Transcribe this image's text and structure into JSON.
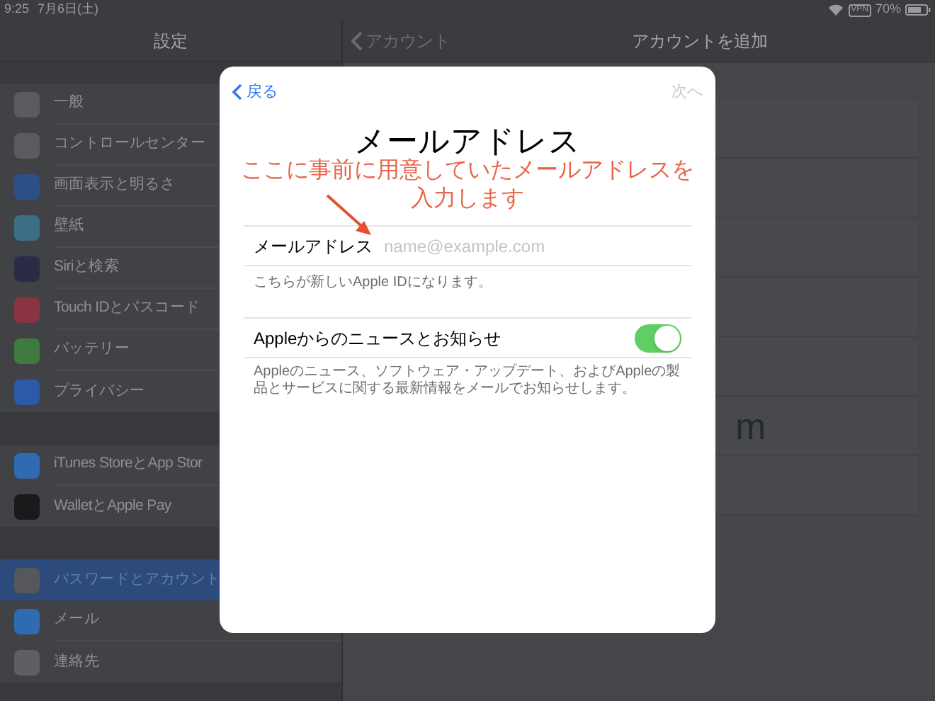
{
  "status_bar": {
    "time": "9:25",
    "date": "7月6日(土)",
    "vpn": "VPN",
    "battery": "70%"
  },
  "sidebar": {
    "title": "設定",
    "groups": [
      [
        {
          "label": "一般",
          "color": "#5a5b5f",
          "selected": false
        },
        {
          "label": "コントロールセンター",
          "color": "#5a5b5f",
          "selected": false
        },
        {
          "label": "画面表示と明るさ",
          "color": "#2c4f86",
          "selected": false
        },
        {
          "label": "壁紙",
          "color": "#3a6f86",
          "selected": false
        },
        {
          "label": "Siriと検索",
          "color": "#2a2b45",
          "selected": false
        },
        {
          "label": "Touch IDとパスコード",
          "color": "#8a3443",
          "selected": false
        },
        {
          "label": "バッテリー",
          "color": "#3f7a3f",
          "selected": false
        },
        {
          "label": "プライバシー",
          "color": "#2d5aa8",
          "selected": false
        }
      ],
      [
        {
          "label": "iTunes StoreとApp Stor",
          "color": "#2f6bb0",
          "selected": false
        },
        {
          "label": "WalletとApple Pay",
          "color": "#1a1a1c",
          "selected": false
        }
      ],
      [
        {
          "label": "パスワードとアカウント",
          "color": "#56575b",
          "selected": true
        },
        {
          "label": "メール",
          "color": "#2f6bb0",
          "selected": false
        },
        {
          "label": "連絡先",
          "color": "#5e5f63",
          "selected": false
        }
      ]
    ]
  },
  "detail": {
    "back": "アカウント",
    "title": "アカウントを追加",
    "cut_text": "m"
  },
  "modal": {
    "back": "戻る",
    "next": {
      "label": "次へ",
      "disabled": true
    },
    "title": "メールアドレス",
    "field": {
      "label": "メールアドレス",
      "placeholder": "name@example.com"
    },
    "field_hint": "こちらが新しいApple IDになります。",
    "toggle": {
      "label": "Appleからのニュースとお知らせ",
      "on": true
    },
    "toggle_hint": "Appleのニュース、ソフトウェア・アップデート、およびAppleの製品とサービスに関する最新情報をメールでお知らせします。"
  },
  "annotation": {
    "text": "ここに事前に用意していたメールアドレスを入力します"
  }
}
